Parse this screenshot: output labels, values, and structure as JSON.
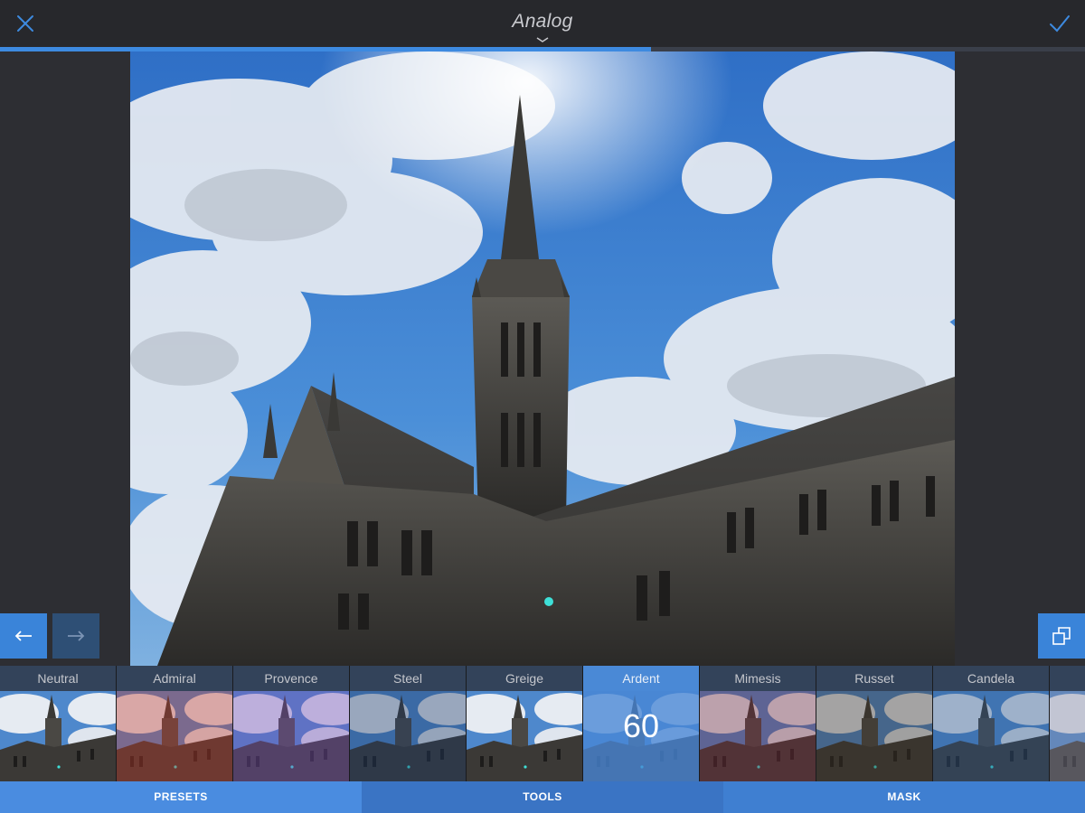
{
  "header": {
    "title": "Analog",
    "close_icon": "close-icon",
    "done_icon": "checkmark-icon",
    "expand_icon": "chevron-down-icon"
  },
  "progress": {
    "value": 0.6
  },
  "photo": {
    "subject": ""
  },
  "controls": {
    "undo_icon": "arrow-left-icon",
    "redo_icon": "arrow-right-icon",
    "compare_icon": "compare-icon"
  },
  "presets": [
    {
      "name": "Neutral",
      "tint": "none"
    },
    {
      "name": "Admiral",
      "tint": "#c43a2a"
    },
    {
      "name": "Provence",
      "tint": "#7b4fb8"
    },
    {
      "name": "Steel",
      "tint": "#1d3b66"
    },
    {
      "name": "Greige",
      "tint": "none"
    },
    {
      "name": "Ardent",
      "tint": "#4a89d6",
      "active": true,
      "value": "60"
    },
    {
      "name": "Mimesis",
      "tint": "#7a2a3a"
    },
    {
      "name": "Russet",
      "tint": "#3a3022"
    },
    {
      "name": "Candela",
      "tint": "#2a5588"
    }
  ],
  "tabs": {
    "presets_label": "PRESETS",
    "tools_label": "TOOLS",
    "mask_label": "MASK"
  },
  "colors": {
    "accent": "#3d8ae0",
    "topbar": "#27282c",
    "background": "#2d2e33"
  }
}
